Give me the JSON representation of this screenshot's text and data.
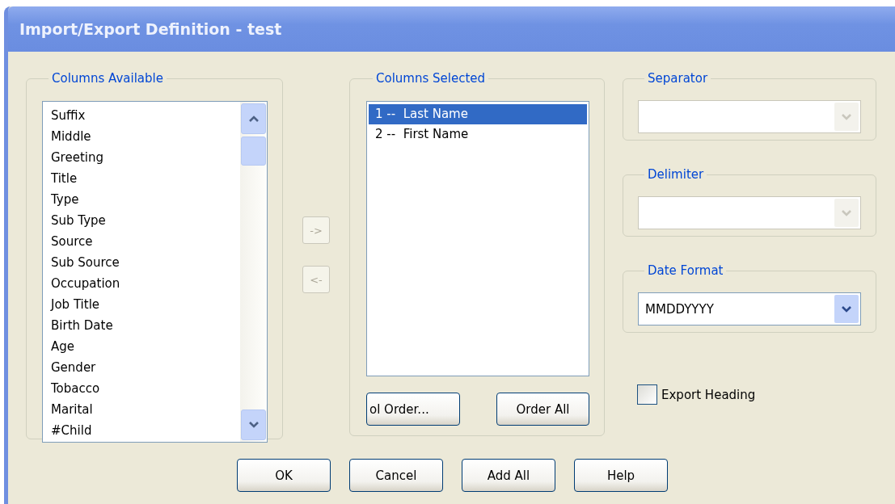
{
  "window": {
    "title": "Import/Export Definition - test"
  },
  "columns_available": {
    "title": "Columns Available",
    "items": [
      "Suffix",
      "Middle",
      "Greeting",
      "Title",
      "Type",
      "Sub Type",
      "Source",
      "Sub Source",
      "Occupation",
      "Job Title",
      "Birth Date",
      "Age",
      "Gender",
      "Tobacco",
      "Marital",
      "#Child"
    ]
  },
  "move_buttons": [
    {
      "label": "->",
      "disabled": true
    },
    {
      "label": "<-",
      "disabled": true
    }
  ],
  "columns_selected": {
    "title": "Columns Selected",
    "items": [
      {
        "label": "1 --  Last Name",
        "selected": true
      },
      {
        "label": "2 --  First Name",
        "selected": false
      }
    ],
    "buttons": [
      {
        "label": "ol Order..."
      },
      {
        "label": "Order All"
      }
    ]
  },
  "separator": {
    "title": "Separator",
    "disabled": true
  },
  "delimiter": {
    "title": "Delimiter",
    "disabled": true
  },
  "date_format": {
    "title": "Date Format",
    "value": "MMDDYYYY",
    "disabled": false
  },
  "export_heading": {
    "label": "Export Heading",
    "checked": false
  },
  "buttons": [
    {
      "label": "OK"
    },
    {
      "label": "Cancel"
    },
    {
      "label": "Add All"
    },
    {
      "label": "Help"
    }
  ]
}
